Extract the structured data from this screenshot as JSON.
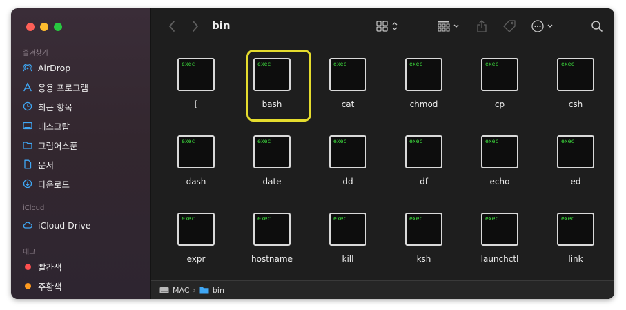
{
  "window": {
    "title": "bin"
  },
  "sidebar": {
    "sections": [
      {
        "title": "즐겨찾기",
        "items": [
          {
            "label": "AirDrop",
            "icon": "airdrop-icon"
          },
          {
            "label": "응용 프로그램",
            "icon": "applications-icon"
          },
          {
            "label": "최근 항목",
            "icon": "clock-icon"
          },
          {
            "label": "데스크탑",
            "icon": "desktop-icon"
          },
          {
            "label": "그럽어스푼",
            "icon": "folder-icon"
          },
          {
            "label": "문서",
            "icon": "document-icon"
          },
          {
            "label": "다운로드",
            "icon": "download-icon"
          }
        ]
      },
      {
        "title": "iCloud",
        "items": [
          {
            "label": "iCloud Drive",
            "icon": "cloud-icon"
          }
        ]
      },
      {
        "title": "태그",
        "items": [
          {
            "label": "빨간색",
            "color": "#fe4f4f"
          },
          {
            "label": "주황색",
            "color": "#fe9a1f"
          }
        ]
      }
    ]
  },
  "files": [
    {
      "name": "[",
      "badge": "exec"
    },
    {
      "name": "bash",
      "badge": "exec",
      "selected": true
    },
    {
      "name": "cat",
      "badge": "exec"
    },
    {
      "name": "chmod",
      "badge": "exec"
    },
    {
      "name": "cp",
      "badge": "exec"
    },
    {
      "name": "csh",
      "badge": "exec"
    },
    {
      "name": "dash",
      "badge": "exec"
    },
    {
      "name": "date",
      "badge": "exec"
    },
    {
      "name": "dd",
      "badge": "exec"
    },
    {
      "name": "df",
      "badge": "exec"
    },
    {
      "name": "echo",
      "badge": "exec"
    },
    {
      "name": "ed",
      "badge": "exec"
    },
    {
      "name": "expr",
      "badge": "exec"
    },
    {
      "name": "hostname",
      "badge": "exec"
    },
    {
      "name": "kill",
      "badge": "exec"
    },
    {
      "name": "ksh",
      "badge": "exec"
    },
    {
      "name": "launchctl",
      "badge": "exec"
    },
    {
      "name": "link",
      "badge": "exec"
    }
  ],
  "pathbar": {
    "root": "MAC",
    "current": "bin"
  },
  "colors": {
    "selection": "#e5dc2e",
    "exec_text": "#3bd33b",
    "folder_blue": "#3fa7f5"
  }
}
